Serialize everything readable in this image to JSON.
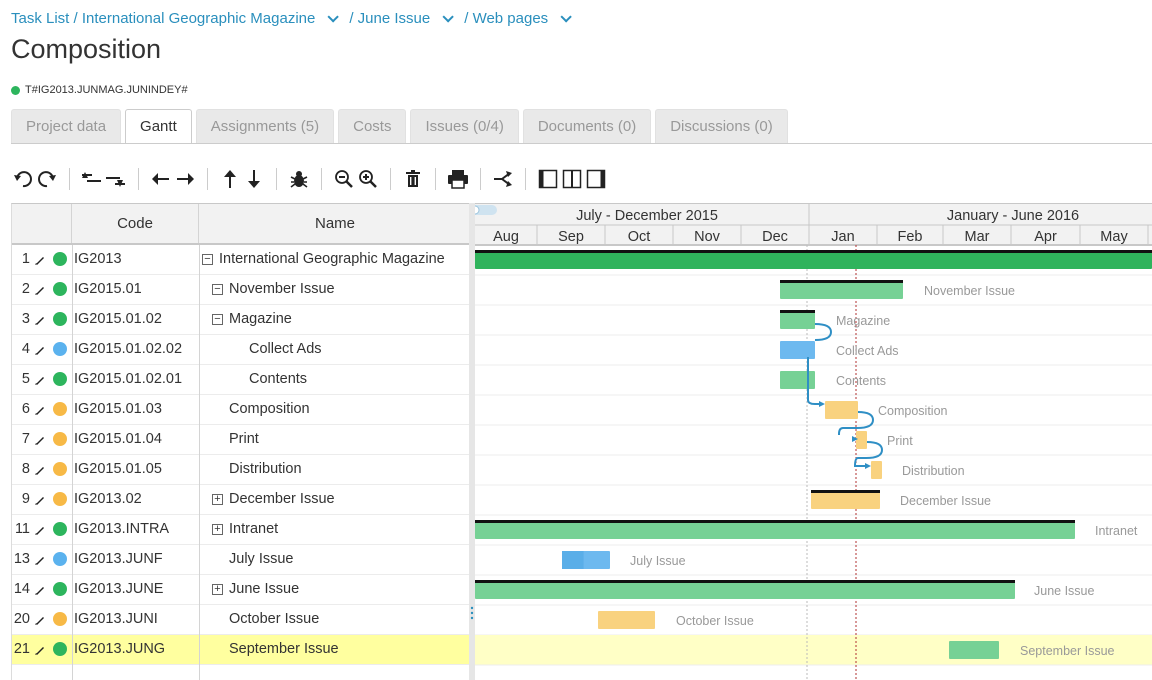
{
  "breadcrumb": {
    "items": [
      "Task List / International Geographic Magazine",
      "/ June Issue",
      "/ Web pages"
    ]
  },
  "page": {
    "title": "Composition",
    "task_code": "T#IG2013.JUNMAG.JUNINDEY#",
    "status_color": "#2db55d"
  },
  "tabs": [
    {
      "label": "Project data"
    },
    {
      "label": "Gantt"
    },
    {
      "label": "Assignments (5)"
    },
    {
      "label": "Costs"
    },
    {
      "label": "Issues (0/4)"
    },
    {
      "label": "Documents (0)"
    },
    {
      "label": "Discussions (0)"
    }
  ],
  "toolbar": {
    "icons": [
      "undo-icon",
      "redo-icon",
      "outdent-icon",
      "indent-icon",
      "move-left-icon",
      "move-right-icon",
      "move-up-icon",
      "move-down-icon",
      "bug-icon",
      "zoom-out-icon",
      "zoom-in-icon",
      "delete-icon",
      "print-icon",
      "critical-path-icon",
      "layout-grid-icon",
      "layout-split-icon",
      "layout-chart-icon"
    ]
  },
  "grid": {
    "headers": {
      "code": "Code",
      "name": "Name"
    },
    "rows": [
      {
        "num": "1",
        "code": "IG2013",
        "name": "International Geographic Magazine",
        "status": "#2db55d",
        "indent": 0,
        "expander": "−"
      },
      {
        "num": "2",
        "code": "IG2015.01",
        "name": "November Issue",
        "status": "#2db55d",
        "indent": 1,
        "expander": "−"
      },
      {
        "num": "3",
        "code": "IG2015.01.02",
        "name": "Magazine",
        "status": "#2db55d",
        "indent": 2,
        "expander": "−"
      },
      {
        "num": "4",
        "code": "IG2015.01.02.02",
        "name": "Collect Ads",
        "status": "#5bb2ee",
        "indent": 3,
        "expander": ""
      },
      {
        "num": "5",
        "code": "IG2015.01.02.01",
        "name": "Contents",
        "status": "#2db55d",
        "indent": 3,
        "expander": ""
      },
      {
        "num": "6",
        "code": "IG2015.01.03",
        "name": "Composition",
        "status": "#f7b946",
        "indent": 2,
        "expander": ""
      },
      {
        "num": "7",
        "code": "IG2015.01.04",
        "name": "Print",
        "status": "#f7b946",
        "indent": 2,
        "expander": ""
      },
      {
        "num": "8",
        "code": "IG2015.01.05",
        "name": "Distribution",
        "status": "#f7b946",
        "indent": 2,
        "expander": ""
      },
      {
        "num": "9",
        "code": "IG2013.02",
        "name": "December Issue",
        "status": "#f7b946",
        "indent": 1,
        "expander": "+"
      },
      {
        "num": "11",
        "code": "IG2013.INTRA",
        "name": "Intranet",
        "status": "#2db55d",
        "indent": 1,
        "expander": "+"
      },
      {
        "num": "13",
        "code": "IG2013.JUNF",
        "name": "July Issue",
        "status": "#5bb2ee",
        "indent": 1,
        "expander": ""
      },
      {
        "num": "14",
        "code": "IG2013.JUNE",
        "name": "June Issue",
        "status": "#2db55d",
        "indent": 1,
        "expander": "+"
      },
      {
        "num": "20",
        "code": "IG2013.JUNI",
        "name": "October Issue",
        "status": "#f7b946",
        "indent": 1,
        "expander": ""
      },
      {
        "num": "21",
        "code": "IG2013.JUNG",
        "name": "September Issue",
        "status": "#2db55d",
        "indent": 1,
        "expander": "",
        "selected": true
      }
    ]
  },
  "gantt": {
    "periods": [
      "July - December 2015",
      "January - June 2016"
    ],
    "months": [
      "Aug",
      "Sep",
      "Oct",
      "Nov",
      "Dec",
      "Jan",
      "Feb",
      "Mar",
      "Apr",
      "May"
    ],
    "bars": [
      {
        "label": "",
        "color": "#2fb35c",
        "start": "Jul",
        "end": "Jun",
        "summary": true
      },
      {
        "label": "November Issue",
        "color": "#76d195",
        "start": "Dec",
        "end": "Jan",
        "summary": true
      },
      {
        "label": "Magazine",
        "color": "#76d195",
        "start": "Dec",
        "end": "Dec",
        "summary": true
      },
      {
        "label": "Collect Ads",
        "color": "#6db9ef",
        "start": "Dec",
        "end": "Dec"
      },
      {
        "label": "Contents",
        "color": "#76d195",
        "start": "Dec",
        "end": "Dec"
      },
      {
        "label": "Composition",
        "color": "#f9d27f",
        "start": "Jan",
        "end": "Jan"
      },
      {
        "label": "Print",
        "color": "#f9d27f",
        "start": "Jan",
        "end": "Jan"
      },
      {
        "label": "Distribution",
        "color": "#f9d27f",
        "start": "Jan",
        "end": "Jan"
      },
      {
        "label": "December Issue",
        "color": "#f9d27f",
        "start": "Dec",
        "end": "Jan",
        "summary": true
      },
      {
        "label": "Intranet",
        "color": "#76d195",
        "start": "Jul",
        "end": "Jun",
        "summary": true
      },
      {
        "label": "July Issue",
        "color": "#6db9ef",
        "start": "Sep",
        "end": "Sep",
        "progress": 0.45
      },
      {
        "label": "June Issue",
        "color": "#76d195",
        "start": "Jul",
        "end": "May",
        "summary": true
      },
      {
        "label": "October Issue",
        "color": "#f9d27f",
        "start": "Sep",
        "end": "Oct"
      },
      {
        "label": "September Issue",
        "color": "#76d195",
        "start": "Mar",
        "end": "Mar"
      }
    ]
  }
}
